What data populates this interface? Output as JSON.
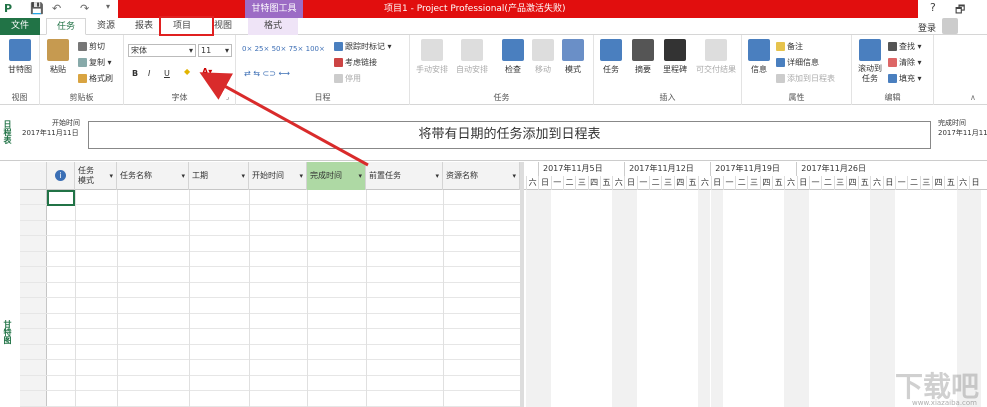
{
  "app": {
    "title": "项目1 - Project Professional(产品激活失败)",
    "context_tab_group": "甘特图工具",
    "signin": "登录",
    "help": "?",
    "restore": "🗗"
  },
  "tabs": [
    "文件",
    "任务",
    "资源",
    "报表",
    "项目",
    "视图",
    "格式"
  ],
  "ribbon": {
    "view": {
      "gantt": "甘特图",
      "group": "视图"
    },
    "clipboard": {
      "paste": "粘贴",
      "cut": "剪切",
      "copy": "复制",
      "format_painter": "格式刷",
      "group": "剪贴板"
    },
    "font": {
      "name": "宋体",
      "size": "11",
      "bold": "B",
      "italic": "I",
      "underline": "U",
      "group": "字体"
    },
    "schedule": {
      "pct": [
        "0×",
        "25×",
        "50×",
        "75×",
        "100×"
      ],
      "mark_on_track": "跟踪时标记",
      "respect_links": "考虑链接",
      "inactivate": "停用",
      "group": "日程"
    },
    "tasks": {
      "manual": "手动安排",
      "auto": "自动安排",
      "inspect": "检查",
      "move": "移动",
      "mode": "模式",
      "group": "任务"
    },
    "insert": {
      "task": "任务",
      "summary": "摘要",
      "milestone": "里程碑",
      "deliverable": "可交付结果",
      "group": "插入"
    },
    "properties": {
      "info": "信息",
      "notes": "备注",
      "details": "详细信息",
      "add_timeline": "添加到日程表",
      "group": "属性"
    },
    "editing": {
      "scroll": "滚动到\n任务",
      "scroll_l1": "滚动到",
      "scroll_l2": "任务",
      "find": "查找",
      "clear": "清除",
      "fill": "填充",
      "group": "编辑"
    }
  },
  "timeline": {
    "label": "日程表",
    "start_label": "开始时间",
    "start_date": "2017年11月11日",
    "end_label": "完成时间",
    "end_date": "2017年11月11日",
    "placeholder": "将带有日期的任务添加到日程表"
  },
  "grid": {
    "side_label": "甘特图",
    "columns": [
      "任务模式",
      "任务名称",
      "工期",
      "开始时间",
      "完成时间",
      "前置任务",
      "资源名称"
    ],
    "col_mode_l1": "任务",
    "col_mode_l2": "模式"
  },
  "gantt": {
    "weeks": [
      "2017年11月5日",
      "2017年11月12日",
      "2017年11月19日",
      "2017年11月26日"
    ],
    "days": [
      "六",
      "日",
      "一",
      "二",
      "三",
      "四",
      "五",
      "六",
      "日",
      "一",
      "二",
      "三",
      "四",
      "五",
      "六",
      "日",
      "一",
      "二",
      "三",
      "四",
      "五",
      "六",
      "日",
      "一",
      "二",
      "三",
      "四",
      "五",
      "六",
      "日",
      "一",
      "二",
      "三",
      "四",
      "五",
      "六",
      "日"
    ]
  },
  "watermark": {
    "text": "下载吧",
    "url": "www.xiazaiba.com"
  },
  "colors": {
    "accent": "#217346",
    "title_bar": "#e10e0e",
    "context_tab": "#9c6cc5",
    "highlight": "#e02020"
  }
}
